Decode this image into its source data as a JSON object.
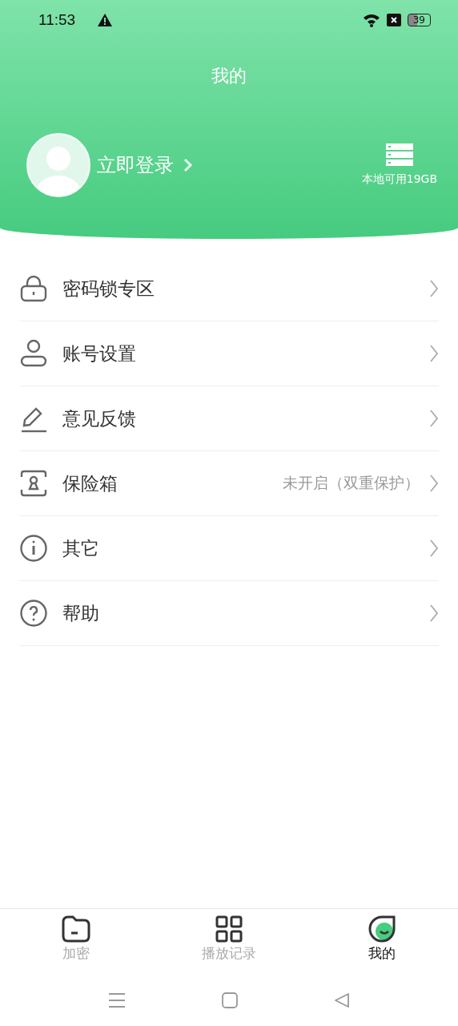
{
  "status_bar": {
    "time": "11:53",
    "battery": "39"
  },
  "header": {
    "title": "我的",
    "login": "立即登录",
    "storage": "本地可用19GB"
  },
  "menu": [
    {
      "label": "密码锁专区"
    },
    {
      "label": "账号设置"
    },
    {
      "label": "意见反馈"
    },
    {
      "label": "保险箱",
      "value": "未开启（双重保护）"
    },
    {
      "label": "其它"
    },
    {
      "label": "帮助"
    }
  ],
  "tabs": [
    {
      "label": "加密",
      "selected": false
    },
    {
      "label": "播放记录",
      "selected": false
    },
    {
      "label": "我的",
      "selected": true
    }
  ]
}
